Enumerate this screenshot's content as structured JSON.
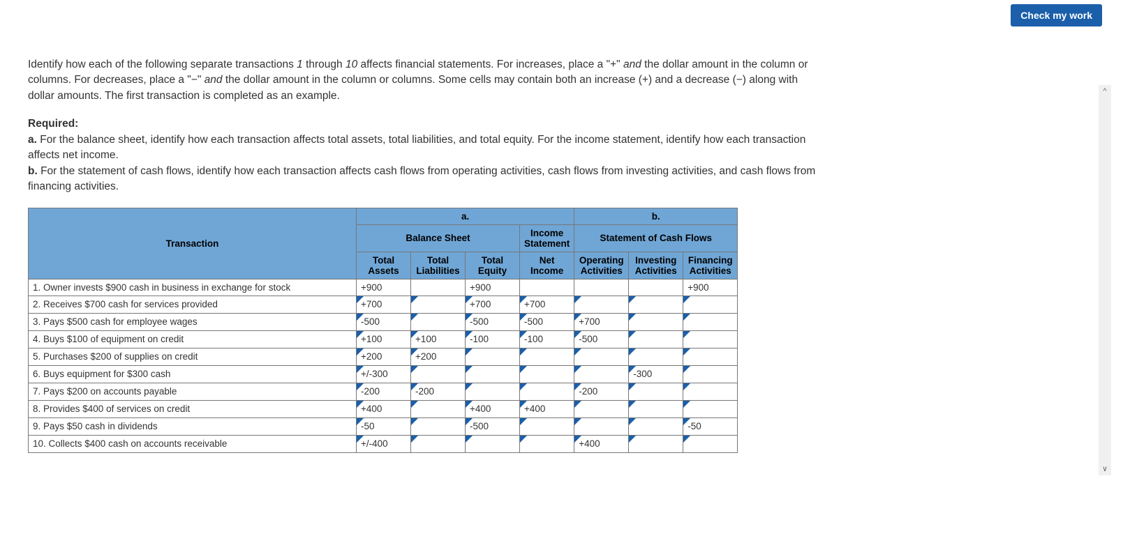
{
  "button_label": "Check my work",
  "intro_html": "Identify how each of the following separate transactions <em>1</em> through <em>10</em> affects financial statements. For increases, place a \"+\" <em>and</em> the dollar amount in the column or columns. For decreases, place a \"&minus;\" <em>and</em> the dollar amount in the column or columns. Some cells may contain both an increase (+) and a decrease (&minus;) along with dollar amounts. The first transaction is completed as an example.",
  "required_label": "Required:",
  "req_a_html": "<b>a.</b> For the balance sheet, identify how each transaction affects total assets, total liabilities, and total equity. For the income statement, identify how each transaction affects net income.",
  "req_b_html": "<b>b.</b> For the statement of cash flows, identify how each transaction affects cash flows from operating activities, cash flows from investing activities, and cash flows from financing activities.",
  "headers": {
    "transaction": "Transaction",
    "a": "a.",
    "b": "b.",
    "balance_sheet": "Balance Sheet",
    "income_statement": "Income Statement",
    "cash_flows": "Statement of Cash Flows",
    "total_assets": "Total Assets",
    "total_liabilities": "Total Liabilities",
    "total_equity": "Total Equity",
    "net_income": "Net Income",
    "operating": "Operating Activities",
    "investing": "Investing Activities",
    "financing": "Financing Activities"
  },
  "rows": [
    {
      "txn": "1. Owner invests $900 cash in business in exchange for stock",
      "cells": [
        {
          "v": "+900",
          "i": false
        },
        {
          "v": "",
          "i": false
        },
        {
          "v": "+900",
          "i": false
        },
        {
          "v": "",
          "i": false
        },
        {
          "v": "",
          "i": false
        },
        {
          "v": "",
          "i": false
        },
        {
          "v": "+900",
          "i": false
        }
      ]
    },
    {
      "txn": "2. Receives $700 cash for services provided",
      "cells": [
        {
          "v": "+700",
          "i": true
        },
        {
          "v": "",
          "i": true
        },
        {
          "v": "+700",
          "i": true
        },
        {
          "v": "+700",
          "i": true
        },
        {
          "v": "",
          "i": true
        },
        {
          "v": "",
          "i": true
        },
        {
          "v": "",
          "i": true
        }
      ]
    },
    {
      "txn": "3. Pays $500 cash for employee wages",
      "cells": [
        {
          "v": "-500",
          "i": true
        },
        {
          "v": "",
          "i": true
        },
        {
          "v": "-500",
          "i": true
        },
        {
          "v": "-500",
          "i": true
        },
        {
          "v": "+700",
          "i": true
        },
        {
          "v": "",
          "i": true
        },
        {
          "v": "",
          "i": true
        }
      ]
    },
    {
      "txn": "4. Buys $100 of equipment on credit",
      "cells": [
        {
          "v": "+100",
          "i": true
        },
        {
          "v": "+100",
          "i": true
        },
        {
          "v": "-100",
          "i": true
        },
        {
          "v": "-100",
          "i": true
        },
        {
          "v": "-500",
          "i": true
        },
        {
          "v": "",
          "i": true
        },
        {
          "v": "",
          "i": true
        }
      ]
    },
    {
      "txn": "5. Purchases $200 of supplies on credit",
      "cells": [
        {
          "v": "+200",
          "i": true
        },
        {
          "v": "+200",
          "i": true
        },
        {
          "v": "",
          "i": true
        },
        {
          "v": "",
          "i": true
        },
        {
          "v": "",
          "i": true
        },
        {
          "v": "",
          "i": true
        },
        {
          "v": "",
          "i": true
        }
      ]
    },
    {
      "txn": "6. Buys equipment for $300 cash",
      "cells": [
        {
          "v": "+/-300",
          "i": true
        },
        {
          "v": "",
          "i": true
        },
        {
          "v": "",
          "i": true
        },
        {
          "v": "",
          "i": true
        },
        {
          "v": "",
          "i": true
        },
        {
          "v": "-300",
          "i": true
        },
        {
          "v": "",
          "i": true
        }
      ]
    },
    {
      "txn": "7. Pays $200 on accounts payable",
      "cells": [
        {
          "v": "-200",
          "i": true
        },
        {
          "v": "-200",
          "i": true
        },
        {
          "v": "",
          "i": true
        },
        {
          "v": "",
          "i": true
        },
        {
          "v": "-200",
          "i": true
        },
        {
          "v": "",
          "i": true
        },
        {
          "v": "",
          "i": true
        }
      ]
    },
    {
      "txn": "8. Provides $400 of services on credit",
      "cells": [
        {
          "v": "+400",
          "i": true
        },
        {
          "v": "",
          "i": true
        },
        {
          "v": "+400",
          "i": true
        },
        {
          "v": "+400",
          "i": true
        },
        {
          "v": "",
          "i": true
        },
        {
          "v": "",
          "i": true
        },
        {
          "v": "",
          "i": true
        }
      ]
    },
    {
      "txn": "9. Pays $50 cash in dividends",
      "cells": [
        {
          "v": "-50",
          "i": true
        },
        {
          "v": "",
          "i": true
        },
        {
          "v": "-500",
          "i": true
        },
        {
          "v": "",
          "i": true
        },
        {
          "v": "",
          "i": true
        },
        {
          "v": "",
          "i": true
        },
        {
          "v": "-50",
          "i": true
        }
      ]
    },
    {
      "txn": "10. Collects $400 cash on accounts receivable",
      "cells": [
        {
          "v": "+/-400",
          "i": true
        },
        {
          "v": "",
          "i": true
        },
        {
          "v": "",
          "i": true
        },
        {
          "v": "",
          "i": true
        },
        {
          "v": "+400",
          "i": true
        },
        {
          "v": "",
          "i": true
        },
        {
          "v": "",
          "i": true
        }
      ]
    }
  ]
}
